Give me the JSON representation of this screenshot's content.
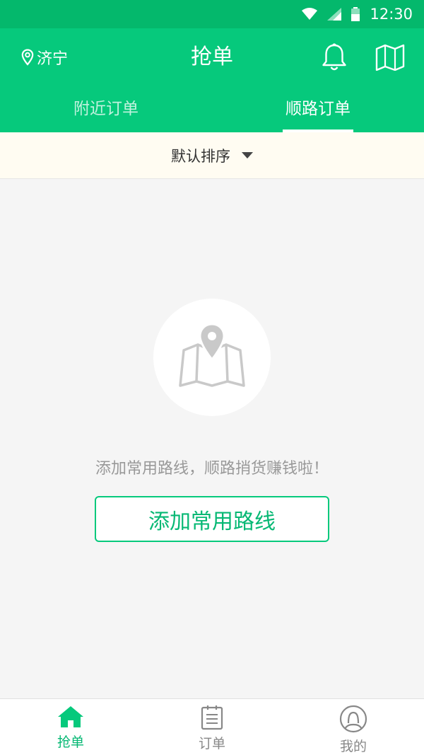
{
  "status_bar": {
    "time": "12:30"
  },
  "header": {
    "location": "济宁",
    "title": "抢单",
    "tabs": [
      {
        "label": "附近订单",
        "active": false
      },
      {
        "label": "顺路订单",
        "active": true
      }
    ]
  },
  "sort_bar": {
    "label": "默认排序"
  },
  "empty_state": {
    "message": "添加常用路线，顺路捎货赚钱啦！",
    "button_label": "添加常用路线"
  },
  "bottom_nav": {
    "items": [
      {
        "label": "抢单",
        "icon": "home-icon",
        "active": true
      },
      {
        "label": "订单",
        "icon": "order-list-icon",
        "active": false
      },
      {
        "label": "我的",
        "icon": "profile-icon",
        "active": false
      }
    ]
  },
  "colors": {
    "primary": "#06c97c",
    "status_bar": "#04b86c",
    "sort_bar_bg": "#fffcf2",
    "page_bg": "#f5f5f5"
  }
}
